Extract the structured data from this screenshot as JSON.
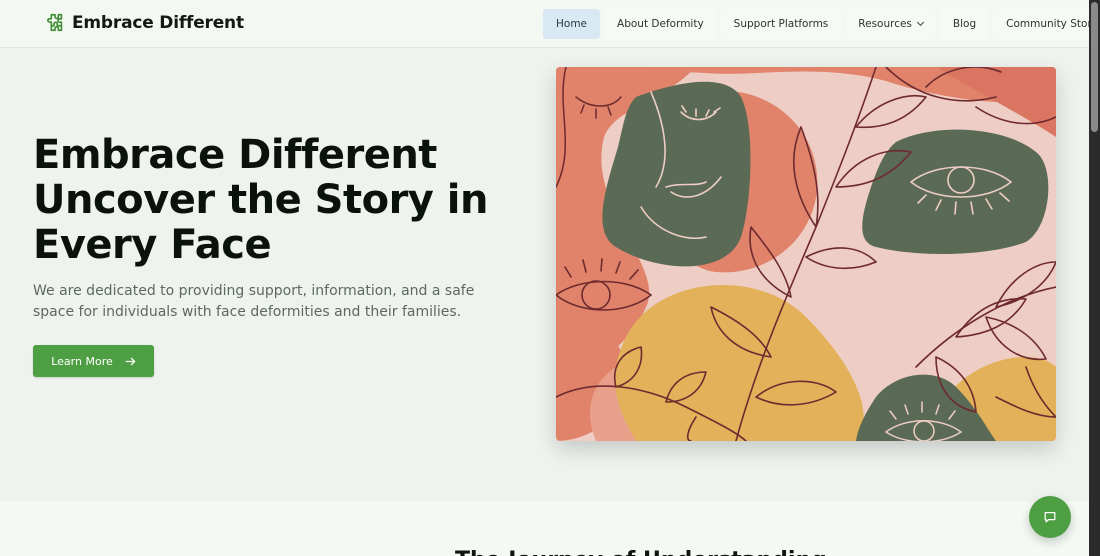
{
  "brand": {
    "name": "Embrace Different",
    "icon": "puzzle-piece-icon"
  },
  "nav": {
    "items": [
      {
        "label": "Home",
        "active": true
      },
      {
        "label": "About Deformity",
        "active": false
      },
      {
        "label": "Support Platforms",
        "active": false
      },
      {
        "label": "Resources",
        "active": false,
        "has_dropdown": true
      },
      {
        "label": "Blog",
        "active": false
      },
      {
        "label": "Community Stories",
        "active": false
      }
    ]
  },
  "hero": {
    "title_lines": [
      "Embrace Different",
      "Uncover the Story in",
      "Every Face"
    ],
    "subtitle": "We are dedicated to providing support, information, and a safe space for individuals with face deformities and their families.",
    "cta_label": "Learn More",
    "cta_icon": "arrow-right-icon",
    "image_alt": "abstract-faces-illustration"
  },
  "next_section": {
    "heading": "The Journey of Understanding"
  },
  "chat": {
    "icon": "chat-bubble-icon"
  },
  "colors": {
    "accent": "#4e9f43",
    "nav_active_bg": "#d9e9f3",
    "page_bg": "#eff3ee",
    "art_pink": "#eecdc4",
    "art_terracotta": "#e0836a",
    "art_green": "#5a6a55",
    "art_mustard": "#e2b15a",
    "art_line": "#6e2a2f"
  }
}
